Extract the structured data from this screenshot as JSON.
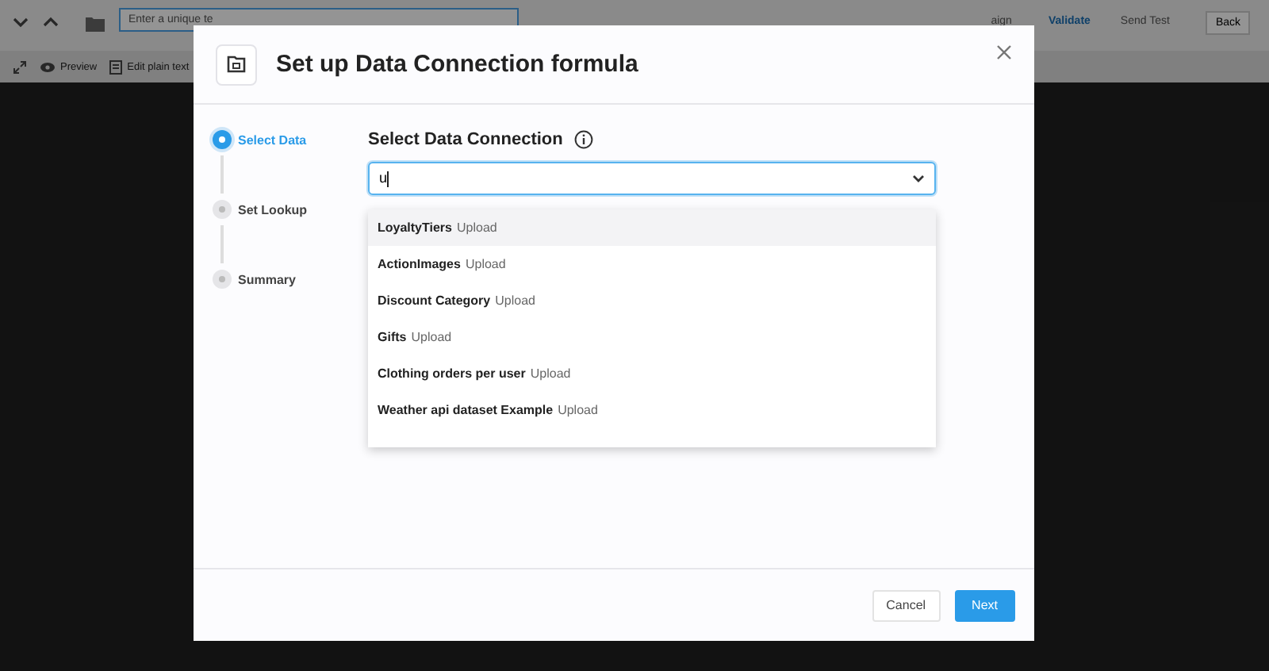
{
  "app_toolbar": {
    "template_name_placeholder": "Enter a unique te",
    "actions": [
      {
        "label": "aign",
        "kind": "link"
      },
      {
        "label": "Validate",
        "kind": "primary-link"
      },
      {
        "label": "Send Test",
        "kind": "link"
      },
      {
        "label": "Back",
        "kind": "button"
      }
    ]
  },
  "app_subbar": {
    "items": [
      {
        "label": "Preview",
        "kind": "eye"
      },
      {
        "label": "Edit plain text",
        "kind": "doc"
      }
    ]
  },
  "dialog": {
    "title": "Set up Data Connection formula",
    "steps": [
      {
        "label": "Select Data",
        "selected": true
      },
      {
        "label": "Set Lookup",
        "selected": false
      },
      {
        "label": "Summary",
        "selected": false
      }
    ],
    "section_title": "Select Data Connection",
    "search": {
      "value": "u"
    },
    "options": [
      {
        "name": "LoyaltyTiers",
        "type": "Upload",
        "selected": true
      },
      {
        "name": "ActionImages",
        "type": "Upload",
        "selected": false
      },
      {
        "name": "Discount Category",
        "type": "Upload",
        "selected": false
      },
      {
        "name": "Gifts",
        "type": "Upload",
        "selected": false
      },
      {
        "name": "Clothing orders per user",
        "type": "Upload",
        "selected": false
      },
      {
        "name": "Weather api dataset Example",
        "type": "Upload",
        "selected": false
      }
    ],
    "buttons": [
      {
        "label": "Cancel",
        "kind": "secondary"
      },
      {
        "label": "Next",
        "kind": "primary"
      }
    ]
  }
}
